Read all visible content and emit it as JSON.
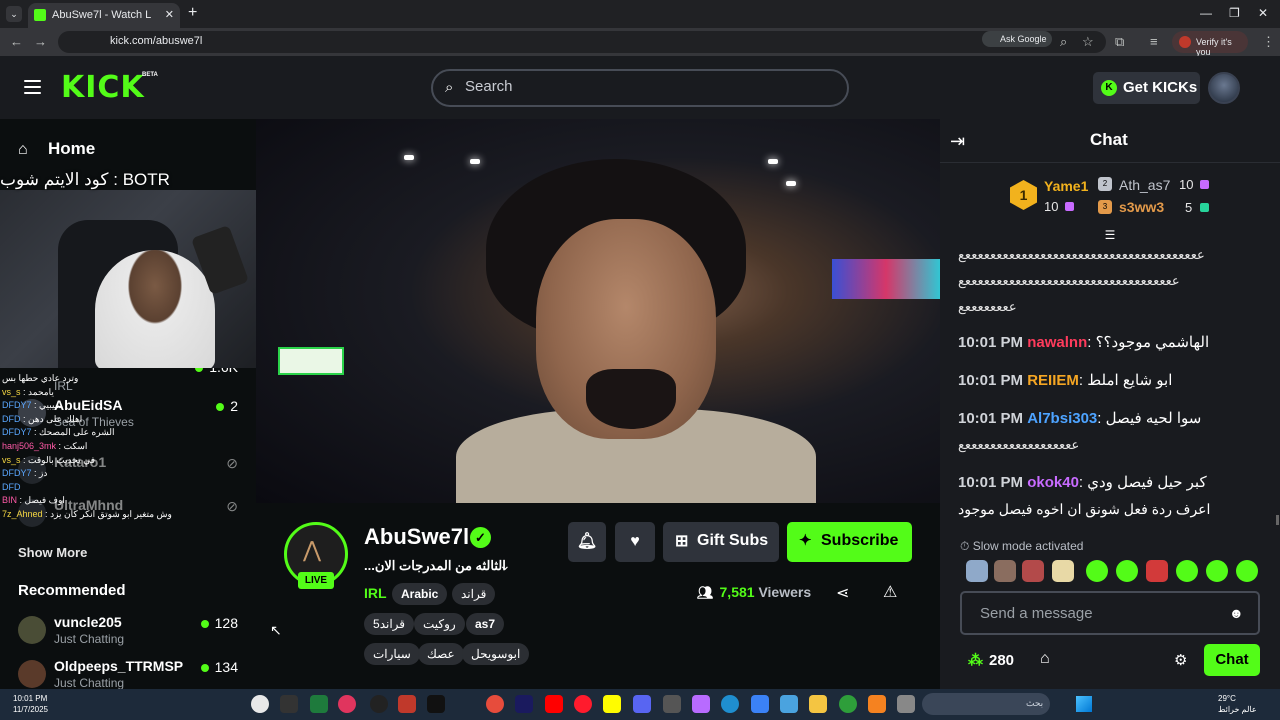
{
  "browser": {
    "tab_title": "AbuSwe7l - Watch L",
    "url": "kick.com/abuswe7l",
    "ask_google": "Ask Google",
    "verify_label": "Verify it's you"
  },
  "header": {
    "logo": "KICK",
    "beta": "BETA",
    "search_placeholder": "Search",
    "get_kicks": "Get KICKs"
  },
  "sidebar": {
    "home": "Home",
    "overlay_text": "كود الايتم شوب : BOTR",
    "following": [
      {
        "name": "AbuEidSA",
        "category": "Sea of Thieves",
        "viewers": "2"
      },
      {
        "name": "Kataro1",
        "category": "",
        "viewers": ""
      },
      {
        "name": "UltraMhnd",
        "category": "",
        "viewers": ""
      }
    ],
    "partial_item": {
      "category": "IRL",
      "viewers": "1.6K"
    },
    "show_more": "Show More",
    "recommended_label": "Recommended",
    "recommended": [
      {
        "name": "vuncle205",
        "category": "Just Chatting",
        "viewers": "128"
      },
      {
        "name": "Oldpeeps_TTRMSP",
        "category": "Just Chatting",
        "viewers": "134"
      }
    ]
  },
  "minichat": [
    {
      "user": "",
      "text": "وترد عادي حطها بس"
    },
    {
      "user": "vs_s",
      "text": "يامحمد"
    },
    {
      "user": "DFDY7",
      "text": "سيبيي"
    },
    {
      "user": "DFD",
      "text": "اهلك على دهن"
    },
    {
      "user": "DFDY7",
      "text": "الشره على المصحك"
    },
    {
      "user": "hanj506_3mk",
      "text": "اسكت"
    },
    {
      "user": "vs_s",
      "text": "في تحديث بالوقت"
    },
    {
      "user": "DFDY7",
      "text": "دز"
    },
    {
      "user": "DFD",
      "text": ""
    },
    {
      "user": "BIN",
      "text": "اوف فيصل"
    },
    {
      "user": "7z_Ahned",
      "text": "وش متغير ابو شوتق انكر كان يزد"
    }
  ],
  "stream": {
    "channel": "AbuSwe7l",
    "title": "...الثالثه من المدرجات الان",
    "live": "LIVE",
    "category": "IRL",
    "tags": [
      "Arabic",
      "قراند",
      "قراند5",
      "روكيت",
      "as7",
      "سيارات",
      "عصك",
      "ابوسويحل"
    ],
    "gift_subs": "Gift Subs",
    "subscribe": "Subscribe",
    "viewers_count": "7,581",
    "viewers_label": "Viewers"
  },
  "chat": {
    "title": "Chat",
    "leaderboard": [
      {
        "rank": "1",
        "name": "Yame1",
        "count": "10"
      },
      {
        "rank": "2",
        "name": "Ath_as7",
        "count": "10"
      },
      {
        "rank": "3",
        "name": "s3ww3",
        "count": "5"
      }
    ],
    "spam_line1": "ععععععععععععععععععععععععععععععععععععععع",
    "spam_line2": "ععععععععععععععععععععععععععععععععععع",
    "spam_line3": "ععععععععع",
    "messages": [
      {
        "time": "10:01 PM",
        "user": "nawalnn",
        "color": "#ff3b5c",
        "text": "الهاشمي موجود؟؟"
      },
      {
        "time": "10:01 PM",
        "user": "REIIEM",
        "color": "#f5a623",
        "text": "ابو شايع املط"
      },
      {
        "time": "10:01 PM",
        "user": "Al7bsi303",
        "color": "#4da3ff",
        "text": "سوا لحيه فيصل"
      },
      {
        "time": "10:01 PM",
        "user": "okok40",
        "color": "#c86bff",
        "text": "كبر حيل فيصل ودي"
      }
    ],
    "msg3_tail": "ععععععععععععععععععع",
    "msg4_tail": "اعرف ردة فعل شونق ان اخوه فيصل موجود",
    "slow_mode": "Slow mode activated",
    "input_placeholder": "Send a message",
    "points": "280",
    "send_label": "Chat"
  },
  "taskbar": {
    "time": "10:01 PM",
    "date": "11/7/2025",
    "search": "بحث",
    "temp": "29°C",
    "weather": "عالم خرائط"
  }
}
